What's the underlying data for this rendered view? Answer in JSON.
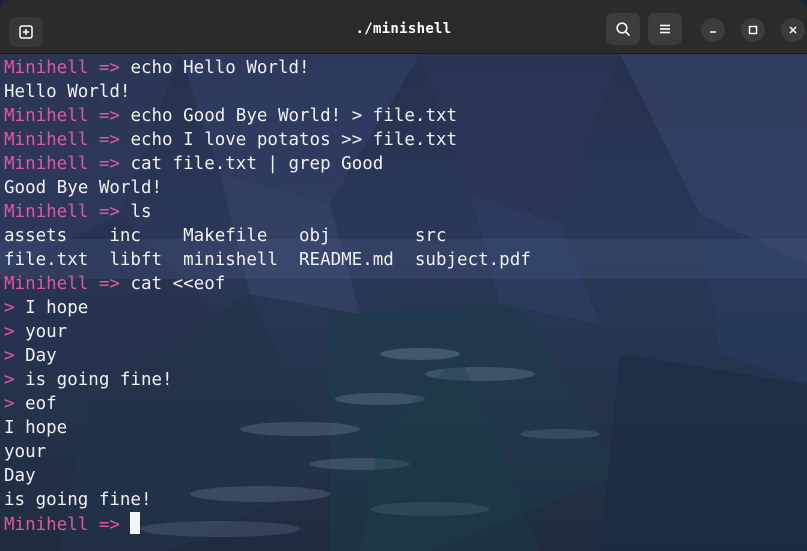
{
  "window": {
    "title": "./minishell"
  },
  "titlebar": {
    "new_tab_icon": "new-tab-icon",
    "search_icon": "search-icon",
    "menu_icon": "hamburger-menu-icon",
    "minimize_icon": "minimize-icon",
    "maximize_icon": "maximize-icon",
    "close_icon": "close-icon"
  },
  "colors": {
    "prompt": "#e0569f",
    "text": "#f0f0f0",
    "titlebar": "#2b2b2b"
  },
  "terminal": {
    "lines": [
      {
        "prompt": "Minihell => ",
        "text": "echo Hello World!"
      },
      {
        "prompt": "",
        "text": "Hello World!"
      },
      {
        "prompt": "Minihell => ",
        "text": "echo Good Bye World! > file.txt"
      },
      {
        "prompt": "Minihell => ",
        "text": "echo I love potatos >> file.txt"
      },
      {
        "prompt": "Minihell => ",
        "text": "cat file.txt | grep Good"
      },
      {
        "prompt": "",
        "text": "Good Bye World!"
      },
      {
        "prompt": "Minihell => ",
        "text": "ls"
      },
      {
        "prompt": "",
        "text": "assets    inc    Makefile   obj        src"
      },
      {
        "prompt": "",
        "text": "file.txt  libft  minishell  README.md  subject.pdf"
      },
      {
        "prompt": "Minihell => ",
        "text": "cat <<eof"
      },
      {
        "prompt": "> ",
        "text": "I hope"
      },
      {
        "prompt": "> ",
        "text": "your"
      },
      {
        "prompt": "> ",
        "text": "Day"
      },
      {
        "prompt": "> ",
        "text": "is going fine!"
      },
      {
        "prompt": "> ",
        "text": "eof"
      },
      {
        "prompt": "",
        "text": "I hope"
      },
      {
        "prompt": "",
        "text": "your"
      },
      {
        "prompt": "",
        "text": "Day"
      },
      {
        "prompt": "",
        "text": "is going fine!"
      },
      {
        "prompt": "Minihell => ",
        "text": ""
      }
    ]
  }
}
